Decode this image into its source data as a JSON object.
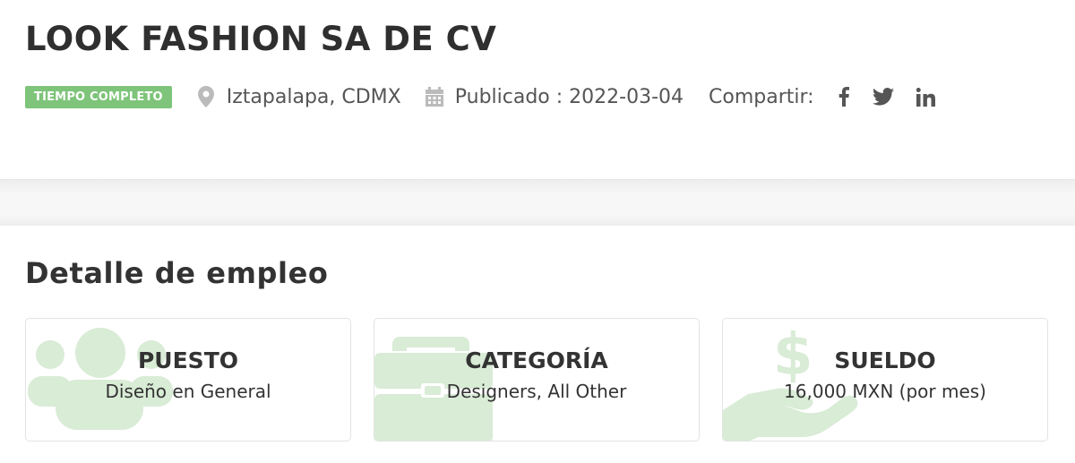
{
  "header": {
    "title": "LOOK FASHION SA DE CV",
    "badge": "TIEMPO COMPLETO",
    "location": "Iztapalapa, CDMX",
    "published": "Publicado : 2022-03-04",
    "share_label": "Compartir:",
    "icons": {
      "location": "map-marker-icon",
      "date": "calendar-icon",
      "facebook": "facebook-icon",
      "twitter": "twitter-icon",
      "linkedin": "linkedin-icon"
    }
  },
  "details": {
    "title": "Detalle de empleo",
    "cards": [
      {
        "label": "PUESTO",
        "value": "Diseño en General",
        "icon": "users-icon"
      },
      {
        "label": "CATEGORÍA",
        "value": "Designers, All Other",
        "icon": "briefcase-icon"
      },
      {
        "label": "SUELDO",
        "value": "16,000 MXN (por mes)",
        "icon": "hand-dollar-icon"
      }
    ]
  },
  "colors": {
    "badge_bg": "#7ec47a",
    "icon_watermark": "#d9ecd6",
    "meta_icon": "#bbbbbb",
    "social_icon": "#555555"
  }
}
